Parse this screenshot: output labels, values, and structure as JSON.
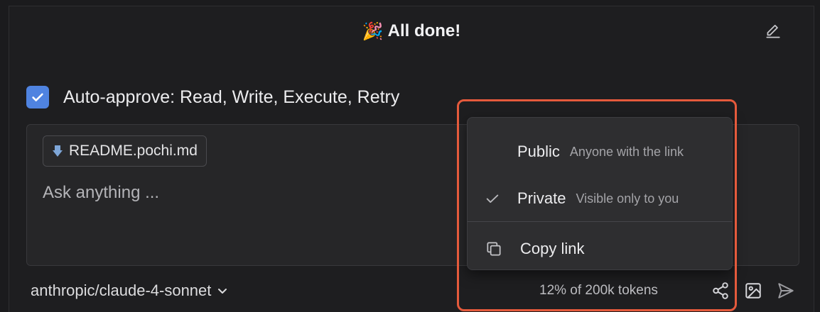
{
  "header": {
    "title": "All done!",
    "title_icon": "party-popper-icon"
  },
  "auto_approve": {
    "checked": true,
    "label": "Auto-approve: Read, Write, Execute, Retry"
  },
  "input": {
    "attachment": {
      "icon": "arrow-down-icon",
      "label": "README.pochi.md"
    },
    "placeholder": "Ask anything ..."
  },
  "footer": {
    "model": "anthropic/claude-4-sonnet",
    "tokens": "12% of 200k tokens"
  },
  "share_menu": {
    "options": [
      {
        "label": "Public",
        "description": "Anyone with the link",
        "selected": false
      },
      {
        "label": "Private",
        "description": "Visible only to you",
        "selected": true
      }
    ],
    "copy_link_label": "Copy link"
  },
  "colors": {
    "accent": "#4f83e0",
    "highlight": "#e55a3c",
    "background": "#1e1e20"
  }
}
